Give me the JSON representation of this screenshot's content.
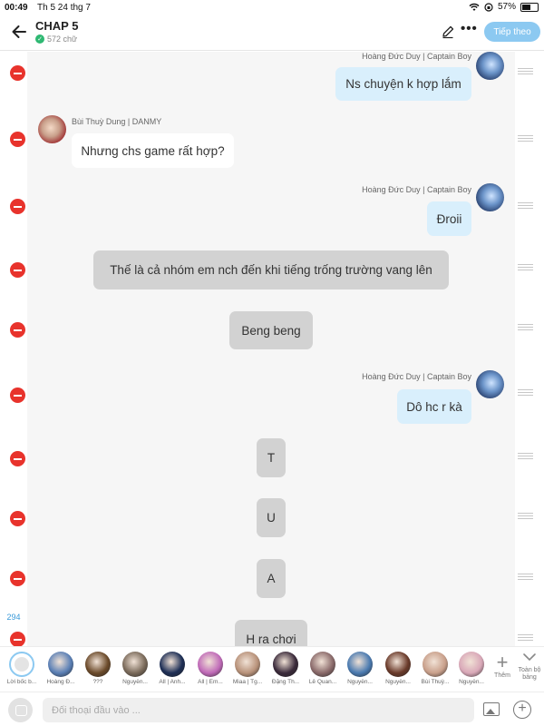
{
  "status_bar": {
    "time": "00:49",
    "date": "Th 5 24 thg 7",
    "battery": "57%",
    "battery_level": 0.57
  },
  "header": {
    "title": "CHAP 5",
    "word_count": "572 chữ",
    "follow_label": "Tiếp theo",
    "accent_color": "#8cc9f1"
  },
  "chat": {
    "messages": [
      {
        "type": "right",
        "speaker": "Hoàng Đức Duy | Captain Boy",
        "text": "Ns chuyện k hợp lắm"
      },
      {
        "type": "left",
        "speaker": "Bùi Thuỳ Dung | DANMY",
        "text": "Nhưng chs game rất hợp?"
      },
      {
        "type": "right",
        "speaker": "Hoàng Đức Duy | Captain Boy",
        "text": "Đroii"
      },
      {
        "type": "narration",
        "text": "Thế là cả nhóm em nch đến khi tiếng trống trường vang lên"
      },
      {
        "type": "narration",
        "text": "Beng beng"
      },
      {
        "type": "right",
        "speaker": "Hoàng Đức Duy | Captain Boy",
        "text": "Dô hc r kà"
      },
      {
        "type": "narration",
        "text": "T"
      },
      {
        "type": "narration",
        "text": "U"
      },
      {
        "type": "narration",
        "text": "A"
      },
      {
        "type": "narration",
        "text": "H ra chơi"
      }
    ],
    "message_count": "294"
  },
  "characters": [
    {
      "name": "Lời bốc b...",
      "kind": "narrator"
    },
    {
      "name": "Hoàng Đ...",
      "color": "#5a7fb5"
    },
    {
      "name": "???",
      "color": "#6b4a2a"
    },
    {
      "name": "Nguyễn...",
      "color": "#7a6a5a"
    },
    {
      "name": "All | Anh...",
      "color": "#1d2e55"
    },
    {
      "name": "All | Em...",
      "color": "#c06ab8"
    },
    {
      "name": "Miaa | Tg...",
      "color": "#b8927a"
    },
    {
      "name": "Đặng Th...",
      "color": "#3a2a3a"
    },
    {
      "name": "Lê Quan...",
      "color": "#8a6a6a"
    },
    {
      "name": "Nguyễn...",
      "color": "#4a7ab0"
    },
    {
      "name": "Nguyễn...",
      "color": "#6a3a2a"
    },
    {
      "name": "Bùi Thuỳ...",
      "color": "#c9a08b"
    },
    {
      "name": "Nguyễn...",
      "color": "#d9a8b8"
    }
  ],
  "toolbar": {
    "add_label": "Thêm",
    "board_label": "Toàn bộ bảng"
  },
  "composer": {
    "placeholder": "Đối thoại đầu vào ..."
  }
}
